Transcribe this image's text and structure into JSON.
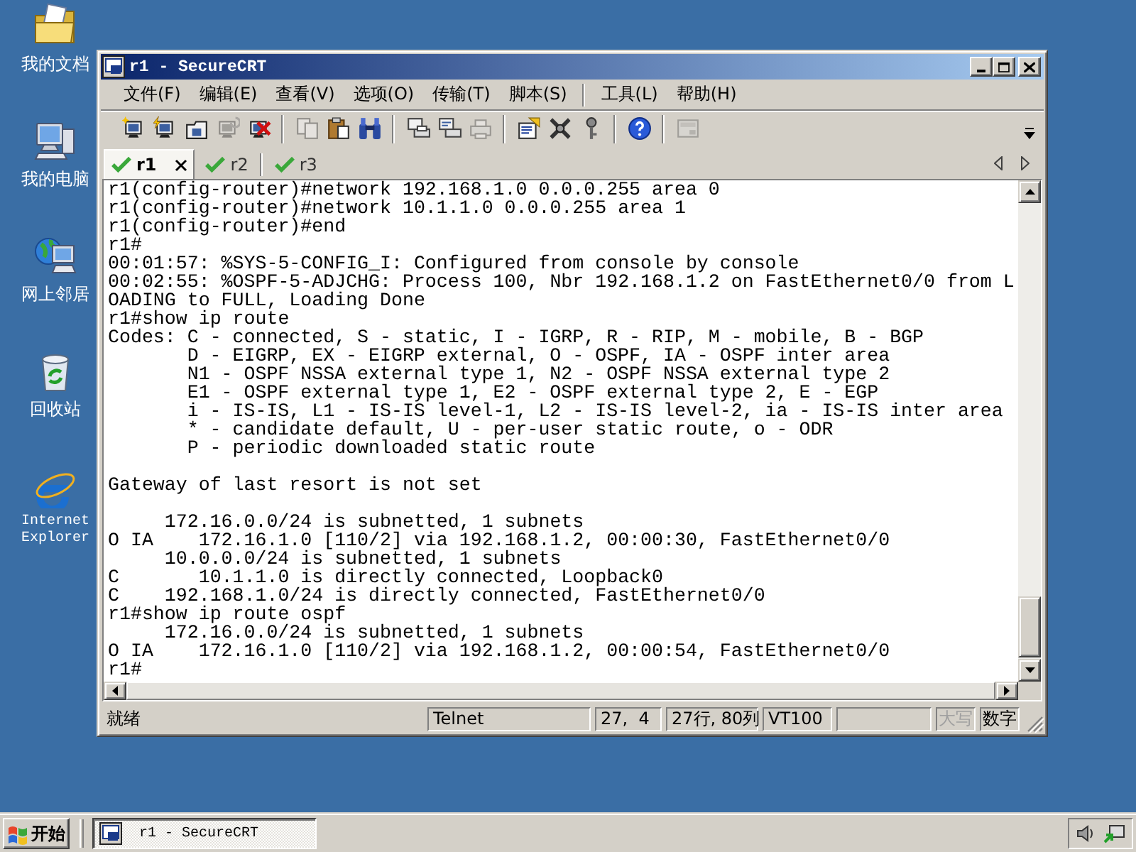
{
  "desktop_icons": [
    {
      "kind": "documents",
      "label": "我的文档"
    },
    {
      "kind": "computer",
      "label": "我的电脑"
    },
    {
      "kind": "network",
      "label": "网上邻居"
    },
    {
      "kind": "recycle",
      "label": "回收站"
    },
    {
      "kind": "browser",
      "label": "Internet Explorer"
    }
  ],
  "window": {
    "title": "r1 - SecureCRT"
  },
  "menu": [
    [
      "文件(F)",
      "编辑(E)",
      "查看(V)",
      "选项(O)",
      "传输(T)",
      "脚本(S)"
    ],
    [
      "工具(L)",
      "帮助(H)"
    ]
  ],
  "toolbar": [
    [
      {
        "kind": "connect",
        "disabled": false
      },
      {
        "kind": "quick-connect",
        "disabled": false
      },
      {
        "kind": "connect-tab",
        "disabled": false
      },
      {
        "kind": "reconnect",
        "disabled": true
      },
      {
        "kind": "disconnect",
        "disabled": false
      }
    ],
    [
      {
        "kind": "copy",
        "disabled": true
      },
      {
        "kind": "paste",
        "disabled": false
      },
      {
        "kind": "find",
        "disabled": false
      }
    ],
    [
      {
        "kind": "print",
        "disabled": false
      },
      {
        "kind": "print-selection",
        "disabled": false
      },
      {
        "kind": "printer",
        "disabled": true
      }
    ],
    [
      {
        "kind": "session-options",
        "disabled": false
      },
      {
        "kind": "global-options",
        "disabled": false
      },
      {
        "kind": "key",
        "disabled": false
      }
    ],
    [
      {
        "kind": "help",
        "disabled": false
      }
    ],
    [
      {
        "kind": "keymap",
        "disabled": true
      }
    ]
  ],
  "tabs": [
    {
      "label": "r1",
      "selected": true
    },
    {
      "label": "r2",
      "selected": false
    },
    {
      "label": "r3",
      "selected": false
    }
  ],
  "terminal": {
    "blocks": [
      [
        "r1(config-router)#network 192.168.1.0 0.0.0.255 area 0",
        "r1(config-router)#network 10.1.1.0 0.0.0.255 area 1",
        "r1(config-router)#end",
        "r1#",
        "00:01:57: %SYS-5-CONFIG_I: Configured from console by console",
        "00:02:55: %OSPF-5-ADJCHG: Process 100, Nbr 192.168.1.2 on FastEthernet0/0 from L",
        "OADING to FULL, Loading Done",
        "r1#show ip route",
        "Codes: C - connected, S - static, I - IGRP, R - RIP, M - mobile, B - BGP",
        "       D - EIGRP, EX - EIGRP external, O - OSPF, IA - OSPF inter area",
        "       N1 - OSPF NSSA external type 1, N2 - OSPF NSSA external type 2",
        "       E1 - OSPF external type 1, E2 - OSPF external type 2, E - EGP",
        "       i - IS-IS, L1 - IS-IS level-1, L2 - IS-IS level-2, ia - IS-IS inter area",
        "       * - candidate default, U - per-user static route, o - ODR",
        "       P - periodic downloaded static route"
      ],
      [
        "Gateway of last resort is not set"
      ],
      [
        "     172.16.0.0/24 is subnetted, 1 subnets",
        "O IA    172.16.1.0 [110/2] via 192.168.1.2, 00:00:30, FastEthernet0/0",
        "     10.0.0.0/24 is subnetted, 1 subnets",
        "C       10.1.1.0 is directly connected, Loopback0",
        "C    192.168.1.0/24 is directly connected, FastEthernet0/0",
        "r1#show ip route ospf",
        "     172.16.0.0/24 is subnetted, 1 subnets",
        "O IA    172.16.1.0 [110/2] via 192.168.1.2, 00:00:54, FastEthernet0/0",
        "r1#"
      ]
    ]
  },
  "status_bar": {
    "message": "就绪",
    "panels": [
      {
        "kind": "text",
        "text": "Telnet"
      },
      {
        "kind": "text",
        "text": "27,  4"
      },
      {
        "kind": "text",
        "text": "27行, 80列"
      },
      {
        "kind": "text",
        "text": "VT100"
      },
      {
        "kind": "blank"
      },
      {
        "kind": "indicator",
        "text": "大写",
        "on": false
      },
      {
        "kind": "indicator",
        "text": "数字",
        "on": true
      }
    ]
  },
  "taskbar": {
    "start_label": "开始",
    "tasks": [
      {
        "title": "r1 - SecureCRT",
        "selected": true
      }
    ]
  }
}
